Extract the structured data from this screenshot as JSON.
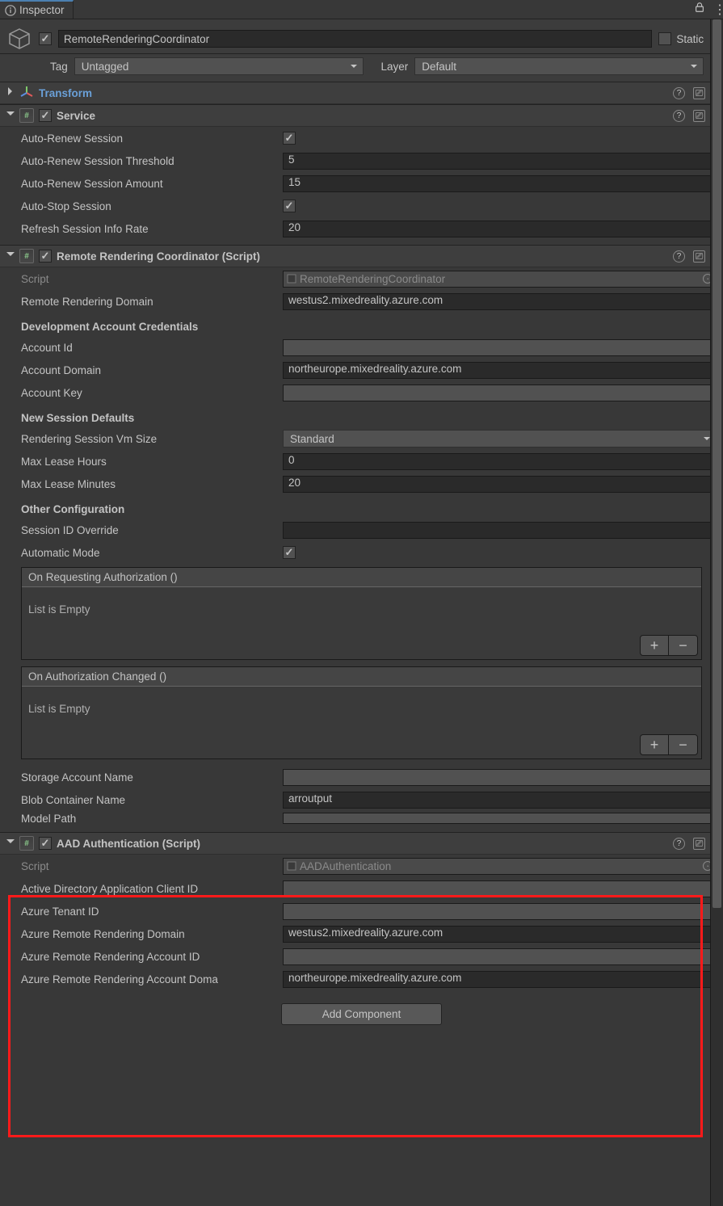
{
  "tab": {
    "title": "Inspector"
  },
  "header": {
    "enabled": true,
    "name": "RemoteRenderingCoordinator",
    "static_label": "Static",
    "static_checked": false,
    "tag_label": "Tag",
    "tag_value": "Untagged",
    "layer_label": "Layer",
    "layer_value": "Default"
  },
  "transform": {
    "title": "Transform"
  },
  "service": {
    "title": "Service",
    "enabled": true,
    "props": {
      "auto_renew_session_label": "Auto-Renew Session",
      "auto_renew_session_checked": true,
      "auto_renew_threshold_label": "Auto-Renew Session Threshold",
      "auto_renew_threshold_value": "5",
      "auto_renew_amount_label": "Auto-Renew Session Amount",
      "auto_renew_amount_value": "15",
      "auto_stop_label": "Auto-Stop Session",
      "auto_stop_checked": true,
      "refresh_rate_label": "Refresh Session Info Rate",
      "refresh_rate_value": "20"
    }
  },
  "rrc": {
    "title": "Remote Rendering Coordinator (Script)",
    "enabled": true,
    "script_label": "Script",
    "script_value": "RemoteRenderingCoordinator",
    "domain_label": "Remote Rendering Domain",
    "domain_value": "westus2.mixedreality.azure.com",
    "dev_creds_heading": "Development Account Credentials",
    "account_id_label": "Account Id",
    "account_id_value": "",
    "account_domain_label": "Account Domain",
    "account_domain_value": "northeurope.mixedreality.azure.com",
    "account_key_label": "Account Key",
    "account_key_value": "",
    "session_defaults_heading": "New Session Defaults",
    "vm_size_label": "Rendering Session Vm Size",
    "vm_size_value": "Standard",
    "max_hours_label": "Max Lease Hours",
    "max_hours_value": "0",
    "max_minutes_label": "Max Lease Minutes",
    "max_minutes_value": "20",
    "other_config_heading": "Other Configuration",
    "session_override_label": "Session ID Override",
    "session_override_value": "",
    "automatic_mode_label": "Automatic Mode",
    "automatic_mode_checked": true,
    "event1_title": "On Requesting Authorization ()",
    "event1_body": "List is Empty",
    "event2_title": "On Authorization Changed ()",
    "event2_body": "List is Empty",
    "storage_account_label": "Storage Account Name",
    "storage_account_value": "",
    "blob_container_label": "Blob Container Name",
    "blob_container_value": "arroutput",
    "model_path_label": "Model Path",
    "model_path_value": ""
  },
  "aad": {
    "title": "AAD Authentication (Script)",
    "enabled": true,
    "script_label": "Script",
    "script_value": "AADAuthentication",
    "client_id_label": "Active Directory Application Client ID",
    "client_id_value": "",
    "tenant_id_label": "Azure Tenant ID",
    "tenant_id_value": "",
    "arr_domain_label": "Azure Remote Rendering Domain",
    "arr_domain_value": "westus2.mixedreality.azure.com",
    "arr_account_id_label": "Azure Remote Rendering Account ID",
    "arr_account_id_value": "",
    "arr_account_domain_label": "Azure Remote Rendering Account Doma",
    "arr_account_domain_value": "northeurope.mixedreality.azure.com"
  },
  "add_component_label": "Add Component"
}
